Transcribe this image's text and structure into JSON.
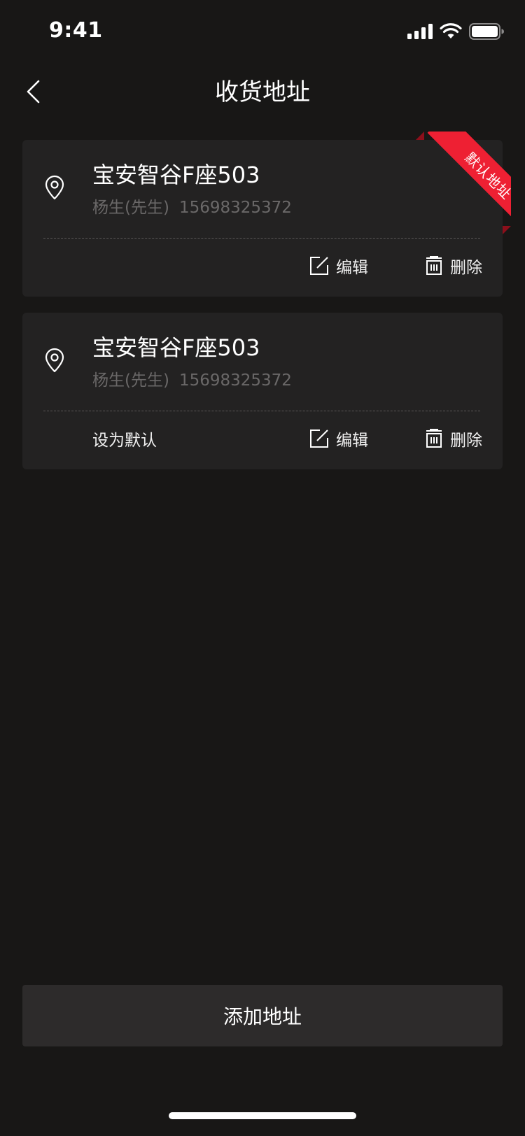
{
  "status_bar": {
    "time": "9:41"
  },
  "nav": {
    "title": "收货地址",
    "back_icon": "chevron-left-icon"
  },
  "addresses": [
    {
      "title": "宝安智谷F座503",
      "name": "杨生(先生)",
      "phone": "15698325372",
      "is_default": true,
      "default_badge": "默认地址",
      "edit_label": "编辑",
      "delete_label": "删除"
    },
    {
      "title": "宝安智谷F座503",
      "name": "杨生(先生)",
      "phone": "15698325372",
      "is_default": false,
      "set_default_label": "设为默认",
      "edit_label": "编辑",
      "delete_label": "删除"
    }
  ],
  "add_button": {
    "label": "添加地址"
  },
  "colors": {
    "background": "#181716",
    "card": "#232222",
    "accent": "#ee2033",
    "button": "#2d2b2b"
  }
}
